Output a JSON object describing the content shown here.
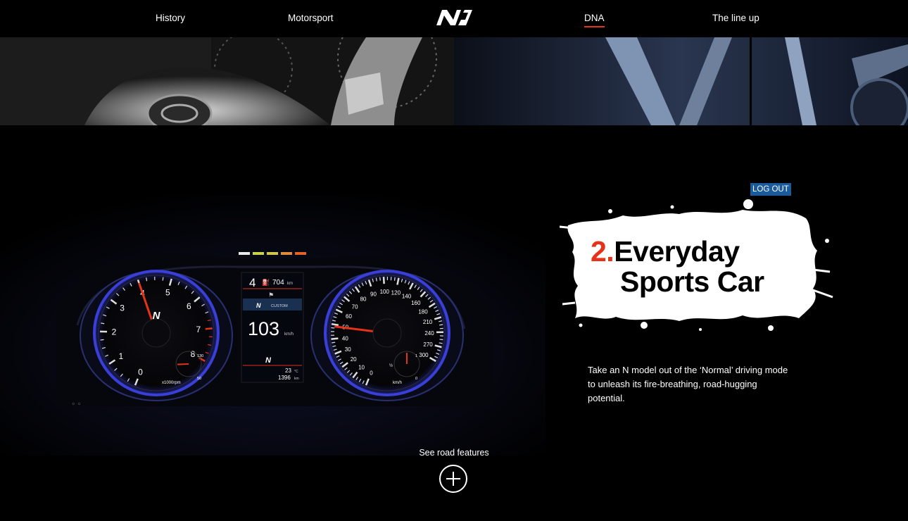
{
  "nav": {
    "items": [
      {
        "label": "History",
        "active": false
      },
      {
        "label": "Motorsport",
        "active": false
      },
      {
        "label": "DNA",
        "active": true
      },
      {
        "label": "The line up",
        "active": false
      }
    ],
    "logo_icon": "n-brand-logo-icon"
  },
  "banner": {
    "left_image": "steering-wheel-image",
    "right_image": "alloy-wheel-image"
  },
  "dashboard": {
    "image": "instrument-cluster-image",
    "tacho": {
      "ticks": [
        "0",
        "1",
        "2",
        "3",
        "4",
        "5",
        "6",
        "7",
        "8"
      ],
      "unit": "x1000rpm",
      "temp_low": "50",
      "temp_high": "130",
      "brand": "N"
    },
    "speedo": {
      "ticks": [
        "0",
        "10",
        "20",
        "30",
        "40",
        "50",
        "60",
        "70",
        "80",
        "90",
        "100",
        "120",
        "140",
        "160",
        "180",
        "210",
        "240",
        "270",
        "300"
      ],
      "unit": "km/h",
      "fuel_full": "1",
      "fuel_half": "½",
      "fuel_empty": "0"
    },
    "center": {
      "gear": "4",
      "range": "704",
      "range_unit": "km",
      "mode": "CUSTOM",
      "speed": "103",
      "speed_unit": "km/h",
      "temp": "23",
      "temp_unit": "°C",
      "odometer": "1396",
      "odo_unit": "km"
    },
    "colors": {
      "accent_red": "#e4321b",
      "ring_blue": "#3a3fd8"
    }
  },
  "account": {
    "logout_label": "LOG OUT"
  },
  "feature": {
    "number": "2.",
    "title_line1": "Everyday",
    "title_line2": "Sports Car",
    "description": "Take an N model out of the ‘Normal’ driving mode to unleash its fire-breathing, road-hugging potential."
  },
  "cta": {
    "label": "See road features",
    "icon": "plus-circle-icon"
  }
}
